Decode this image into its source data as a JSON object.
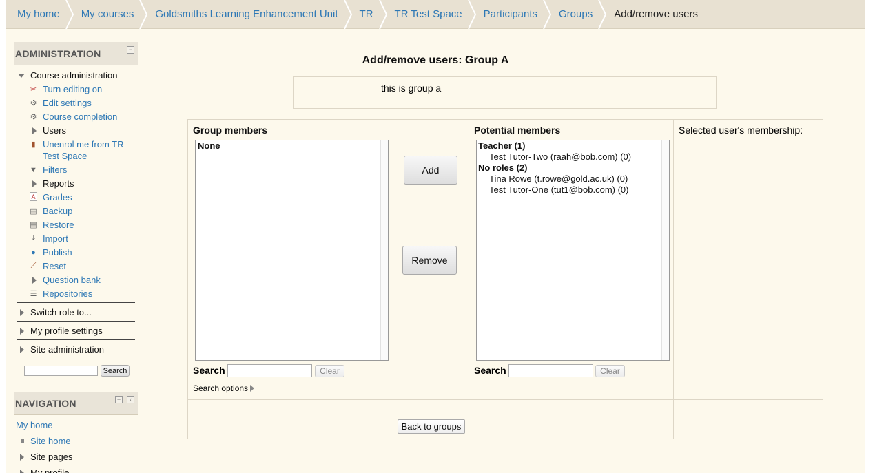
{
  "breadcrumb": [
    "My home",
    "My courses",
    "Goldsmiths Learning Enhancement Unit",
    "TR",
    "TR Test Space",
    "Participants",
    "Groups",
    "Add/remove users"
  ],
  "administration": {
    "title": "ADMINISTRATION",
    "course_admin": "Course administration",
    "items": {
      "turn_editing": "Turn editing on",
      "edit_settings": "Edit settings",
      "course_completion": "Course completion",
      "users": "Users",
      "unenrol_1": "Unenrol me from TR",
      "unenrol_2": "Test Space",
      "filters": "Filters",
      "reports": "Reports",
      "grades": "Grades",
      "backup": "Backup",
      "restore": "Restore",
      "import": "Import",
      "publish": "Publish",
      "reset": "Reset",
      "question_bank": "Question bank",
      "repositories": "Repositories"
    },
    "switch_role": "Switch role to...",
    "profile_settings": "My profile settings",
    "site_admin": "Site administration",
    "search_button": "Search"
  },
  "navigation": {
    "title": "NAVIGATION",
    "my_home": "My home",
    "site_home": "Site home",
    "site_pages": "Site pages",
    "my_profile": "My profile"
  },
  "main": {
    "title": "Add/remove users: Group A",
    "description": "this is group a",
    "group_members_label": "Group members",
    "group_members": [
      "None"
    ],
    "potential_label": "Potential members",
    "potential": {
      "teacher_group": "Teacher (1)",
      "teacher_users": [
        "Test Tutor-Two (raah@bob.com) (0)"
      ],
      "noroles_group": "No roles (2)",
      "noroles_users": [
        "Tina Rowe (t.rowe@gold.ac.uk) (0)",
        "Test Tutor-One (tut1@bob.com) (0)"
      ]
    },
    "add_button": "Add",
    "remove_button": "Remove",
    "search_label": "Search",
    "clear_button": "Clear",
    "search_options": "Search options",
    "membership_label": "Selected user's membership:",
    "back_button": "Back to groups"
  }
}
